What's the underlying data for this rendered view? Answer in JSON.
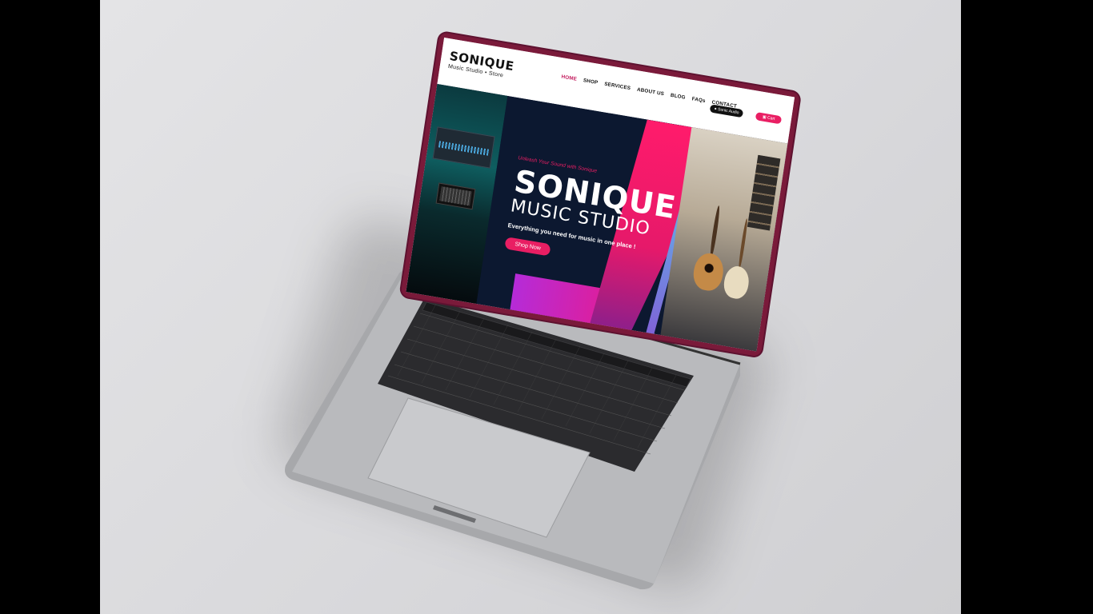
{
  "site": {
    "logo_title": "SONIQUE",
    "logo_subtitle": "Music Studio • Store"
  },
  "nav": {
    "items": [
      {
        "label": "HOME",
        "active": true
      },
      {
        "label": "SHOP"
      },
      {
        "label": "SERVICES"
      },
      {
        "label": "ABOUT US"
      },
      {
        "label": "BLOG"
      },
      {
        "label": "FAQs"
      },
      {
        "label": "CONTACT"
      }
    ],
    "login_label": "Sonic Audio",
    "cart_label": "Cart"
  },
  "hero": {
    "tagline": "Unleash Your Sound with Sonique",
    "title": "SONIQUE",
    "subtitle": "MUSIC STUDIO",
    "description": "Everything you need for music in one place !",
    "cta_label": "Shop Now"
  },
  "colors": {
    "accent": "#e91e63",
    "lid": "#7a1a3a",
    "hero_bg": "#0c1830",
    "cyan": "#53d6ef"
  }
}
